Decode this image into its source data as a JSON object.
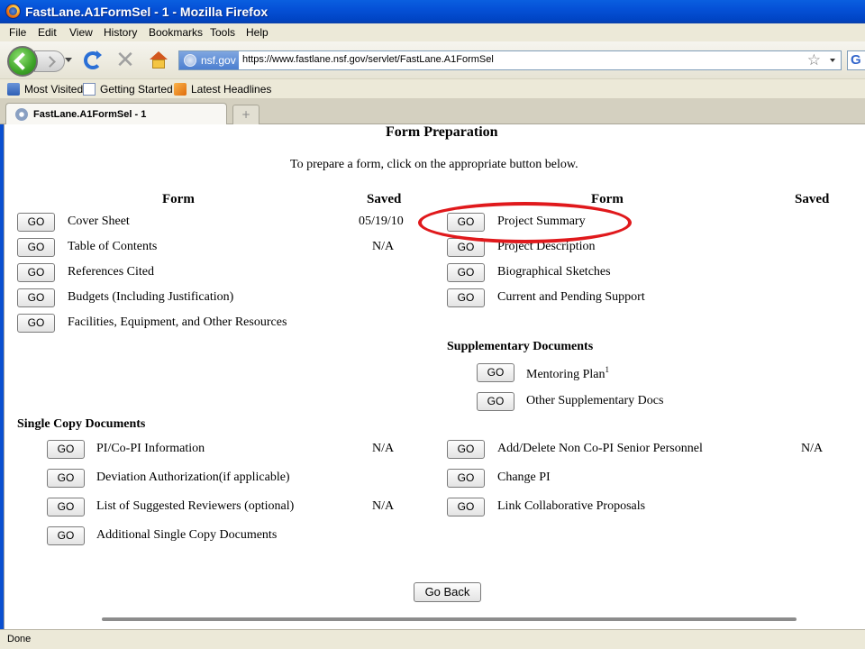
{
  "window": {
    "title": "FastLane.A1FormSel - 1 - Mozilla Firefox"
  },
  "menu": [
    "File",
    "Edit",
    "View",
    "History",
    "Bookmarks",
    "Tools",
    "Help"
  ],
  "nav": {
    "site_badge": "nsf.gov",
    "url": "https://www.fastlane.nsf.gov/servlet/FastLane.A1FormSel",
    "search_engine_letter": "G"
  },
  "bookmarks": [
    "Most Visited",
    "Getting Started",
    "Latest Headlines"
  ],
  "tabs": [
    {
      "label": "FastLane.A1FormSel - 1"
    }
  ],
  "page": {
    "heading": "Form Preparation",
    "instruction": "To prepare a form, click on the appropriate button below.",
    "col_headers": {
      "form": "Form",
      "saved": "Saved"
    },
    "go_label": "GO",
    "left_forms": [
      {
        "name": "Cover Sheet",
        "saved": "05/19/10"
      },
      {
        "name": "Table of Contents",
        "saved": "N/A"
      },
      {
        "name": "References Cited",
        "saved": ""
      },
      {
        "name": "Budgets (Including Justification)",
        "saved": ""
      },
      {
        "name": "Facilities, Equipment, and Other Resources",
        "saved": ""
      }
    ],
    "right_forms": [
      {
        "name": "Project Summary",
        "saved": ""
      },
      {
        "name": "Project Description",
        "saved": ""
      },
      {
        "name": "Biographical Sketches",
        "saved": ""
      },
      {
        "name": "Current and Pending Support",
        "saved": ""
      }
    ],
    "supplementary": {
      "heading": "Supplementary Documents",
      "items": [
        {
          "name": "Mentoring Plan",
          "sup": "1"
        },
        {
          "name": "Other Supplementary Docs",
          "sup": ""
        }
      ]
    },
    "single_copy": {
      "heading": "Single Copy Documents",
      "left": [
        {
          "name": "PI/Co-PI Information",
          "saved": "N/A"
        },
        {
          "name": "Deviation Authorization(if applicable)",
          "saved": ""
        },
        {
          "name": "List of Suggested Reviewers (optional)",
          "saved": "N/A"
        },
        {
          "name": "Additional Single Copy Documents",
          "saved": ""
        }
      ],
      "right": [
        {
          "name": "Add/Delete Non Co-PI Senior Personnel",
          "saved": "N/A"
        },
        {
          "name": "Change PI",
          "saved": ""
        },
        {
          "name": "Link Collaborative Proposals",
          "saved": ""
        }
      ]
    },
    "go_back_label": "Go Back"
  },
  "status": "Done",
  "colors": {
    "highlight": "#e0191c",
    "title_bar": "#0550d6"
  }
}
